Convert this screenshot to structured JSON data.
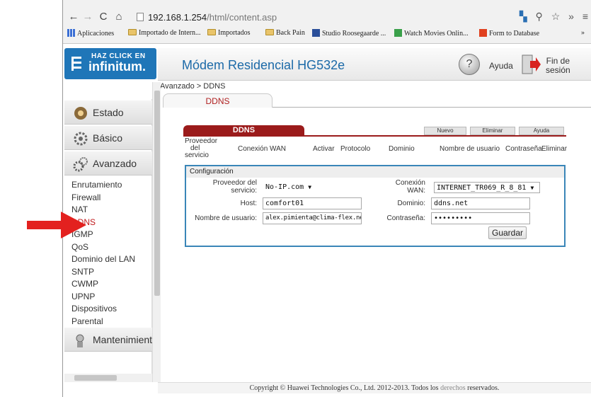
{
  "browser": {
    "url_host": "192.168.1.254",
    "url_path": "/html/content.asp",
    "bookmarks": [
      "Aplicaciones",
      "Importado de Intern...",
      "Importados",
      "Back Pain",
      "Studio Roosegaarde ...",
      "Watch Movies Onlin...",
      "Form to Database"
    ],
    "overflow": "»"
  },
  "logo": {
    "line1": "HAZ CLICK EN",
    "line2": "infinitum."
  },
  "header": {
    "title": "Módem Residencial HG532e",
    "help": "Ayuda",
    "logout_line1": "Fin de",
    "logout_line2": "sesión"
  },
  "breadcrumb": "Avanzado > DDNS",
  "tab": "DDNS",
  "sidebar": {
    "main": [
      "Estado",
      "Básico",
      "Avanzado",
      "Mantenimiento"
    ],
    "sub": [
      "Enrutamiento",
      "Firewall",
      "NAT",
      "DDNS",
      "IGMP",
      "QoS",
      "Dominio del LAN",
      "SNTP",
      "CWMP",
      "UPNP",
      "Dispositivos",
      "Parental"
    ]
  },
  "panel": {
    "tab": "DDNS",
    "buttons": {
      "new": "Nuevo",
      "delete": "Eliminar",
      "help": "Ayuda"
    },
    "columns": {
      "provider_1": "Proveedor",
      "provider_2": "del",
      "provider_3": "servicio",
      "wan": "Conexión WAN",
      "activate": "Activar",
      "protocol": "Protocolo",
      "domain": "Dominio",
      "username": "Nombre de usuario",
      "password": "Contraseña",
      "remove": "Eliminar"
    },
    "config": {
      "title": "Configuración",
      "provider_label_1": "Proveedor del",
      "provider_label_2": "servicio:",
      "provider_value": "No-IP.com",
      "wan_label_1": "Conexión",
      "wan_label_2": "WAN:",
      "wan_value": "INTERNET_TR069_R_8_81",
      "host_label": "Host:",
      "host_value": "comfort01",
      "domain_label": "Dominio:",
      "domain_value": "ddns.net",
      "user_label": "Nombre de usuario:",
      "user_value": "alex.pimienta@clima-flex.net",
      "password_label": "Contraseña:",
      "password_value": "•••••••••",
      "save": "Guardar"
    }
  },
  "footer": {
    "text": "Copyright © Huawei Technologies Co., Ltd. 2012-2013. Todos los",
    "link": "derechos",
    "tail": "reservados."
  },
  "colors": {
    "brand_blue": "#1f76b8",
    "tab_red": "#9b1b1b",
    "active_red": "#c0191b",
    "arrow_red": "#e3211f",
    "config_border": "#3a86b8"
  }
}
